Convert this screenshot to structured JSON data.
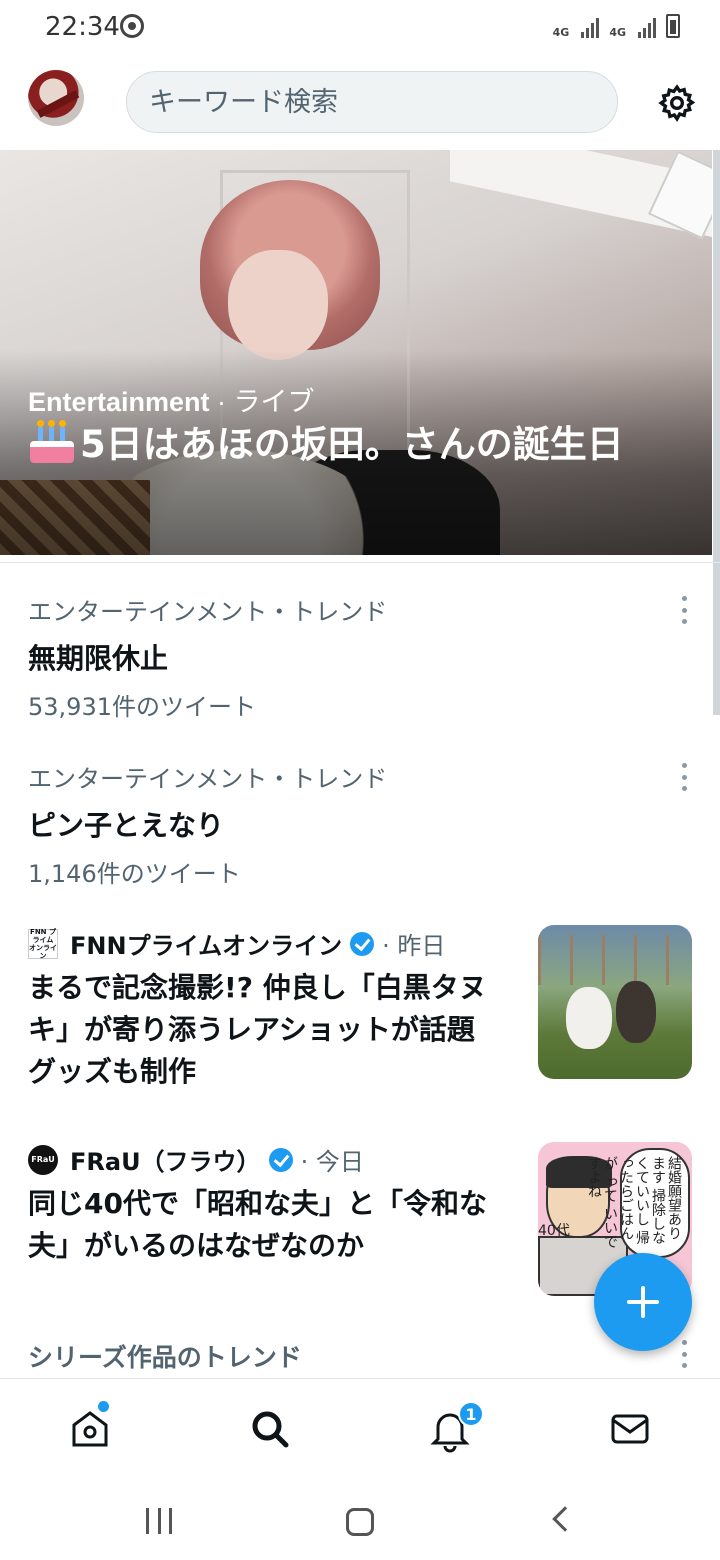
{
  "status_bar": {
    "time": "22:34",
    "net1": "4G",
    "net2": "4G"
  },
  "header": {
    "search_placeholder": "キーワード検索"
  },
  "hero": {
    "category": "Entertainment",
    "category_rest": " · ライブ",
    "title": "5日はあほの坂田。さんの誕生日"
  },
  "trends": [
    {
      "meta": "エンターテインメント・トレンド",
      "name": "無期限休止",
      "count": "53,931件のツイート"
    },
    {
      "meta": "エンターテインメント・トレンド",
      "name": "ピン子とえなり",
      "count": "1,146件のツイート"
    }
  ],
  "news": [
    {
      "source": "FNNプライムオンライン",
      "logo_text": "FNN プライム オンライン",
      "time": "· 昨日",
      "headline": "まるで記念撮影!? 仲良し「白黒タヌキ」が寄り添うレアショットが話題　グッズも制作"
    },
    {
      "source": "FRaU（フラウ）",
      "logo_text": "FRaU",
      "time": "· 今日",
      "headline": "同じ40代で「昭和な夫」と「令和な夫」がいるのはなぜなのか",
      "thumb_bubble": "結婚願望あります 掃除しなくていいし 帰ったらごはんが って いいですよね",
      "thumb_age": "40代"
    }
  ],
  "section": {
    "title": "シリーズ作品のトレンド"
  },
  "bottom_nav": {
    "notifications_badge": "1"
  },
  "colors": {
    "accent": "#1d9bf0",
    "text": "#0f1419",
    "muted": "#536471"
  },
  "icons": [
    "sync-icon",
    "signal-icon",
    "battery-icon",
    "gear-icon",
    "more-icon",
    "verified-icon",
    "plus-icon",
    "home-icon",
    "search-icon",
    "bell-icon",
    "mail-icon"
  ]
}
